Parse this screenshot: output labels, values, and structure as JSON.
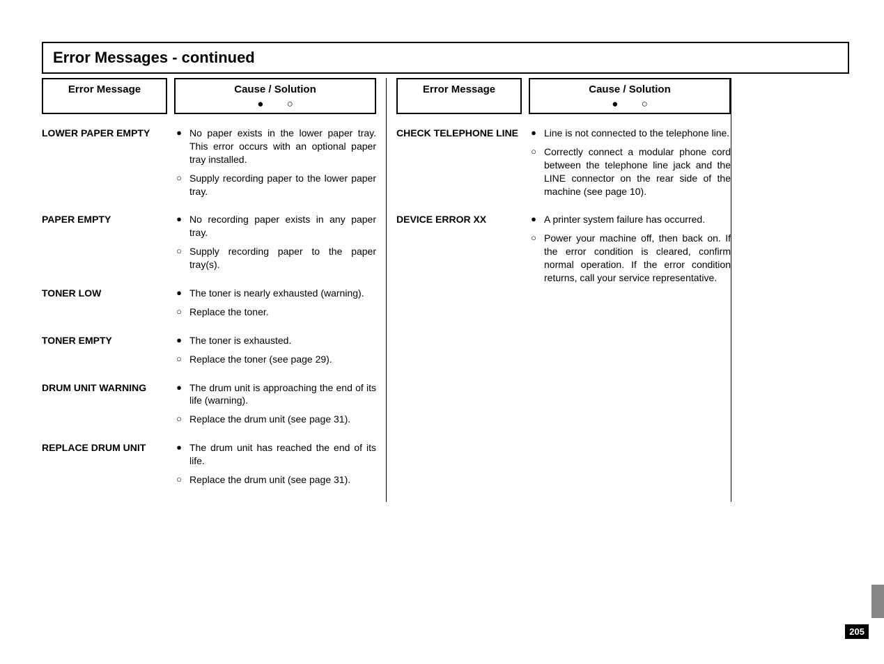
{
  "title": "Error Messages - continued",
  "headers": {
    "msg": "Error Message",
    "cause": "Cause / Solution",
    "legend_filled": "●",
    "legend_open": "○"
  },
  "left_rows": [
    {
      "msg": "LOWER PAPER EMPTY",
      "items": [
        {
          "bullet": "●",
          "text": "No paper exists in the lower paper tray. This error occurs with an optional paper tray installed."
        },
        {
          "bullet": "○",
          "text": "Supply recording paper to the lower paper tray."
        }
      ]
    },
    {
      "msg": "PAPER EMPTY",
      "items": [
        {
          "bullet": "●",
          "text": "No recording paper exists in any paper tray."
        },
        {
          "bullet": "○",
          "text": "Supply recording paper to the paper tray(s)."
        }
      ]
    },
    {
      "msg": "TONER LOW",
      "items": [
        {
          "bullet": "●",
          "text": "The toner is nearly exhausted (warning)."
        },
        {
          "bullet": "○",
          "text": "Replace the toner."
        }
      ]
    },
    {
      "msg": "TONER EMPTY",
      "items": [
        {
          "bullet": "●",
          "text": "The toner is exhausted."
        },
        {
          "bullet": "○",
          "text": "Replace the toner (see page 29)."
        }
      ]
    },
    {
      "msg": "DRUM UNIT WARNING",
      "items": [
        {
          "bullet": "●",
          "text": "The drum unit is approaching the end of its life (warning)."
        },
        {
          "bullet": "○",
          "text": "Replace the drum unit (see page 31)."
        }
      ]
    },
    {
      "msg": "REPLACE DRUM UNIT",
      "items": [
        {
          "bullet": "●",
          "text": "The drum unit has reached the end of its life."
        },
        {
          "bullet": "○",
          "text": "Replace the drum unit (see page 31)."
        }
      ]
    }
  ],
  "right_rows": [
    {
      "msg": "CHECK TELEPHONE LINE",
      "items": [
        {
          "bullet": "●",
          "text": "Line is not connected to the telephone line."
        },
        {
          "bullet": "○",
          "text": "Correctly connect a modular phone cord between the telephone line jack and the LINE connector on the rear side of the machine (see page 10)."
        }
      ]
    },
    {
      "msg": "DEVICE ERROR XX",
      "items": [
        {
          "bullet": "●",
          "text": "A printer system failure has occurred."
        },
        {
          "bullet": "○",
          "text": "Power your machine off, then back on. If the error condition is cleared, confirm normal operation. If the error condition returns, call your service representative."
        }
      ]
    }
  ],
  "page_number": "205"
}
